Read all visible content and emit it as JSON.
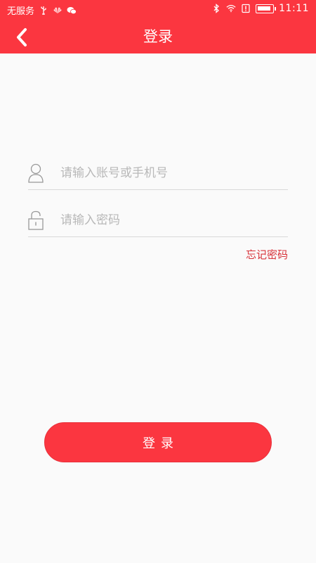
{
  "status_bar": {
    "carrier": "无服务",
    "time": "11:11",
    "left_icons": [
      "usb-icon",
      "huawei-icon",
      "wechat-icon"
    ],
    "right_icons": [
      "bluetooth-icon",
      "wifi-icon",
      "alert-icon",
      "battery-icon"
    ]
  },
  "header": {
    "title": "登录",
    "back_icon": "chevron-left-icon",
    "color": "#fb3640"
  },
  "form": {
    "account": {
      "icon": "user-icon",
      "value": "",
      "placeholder": "请输入账号或手机号"
    },
    "password": {
      "icon": "lock-icon",
      "value": "",
      "placeholder": "请输入密码"
    },
    "forgot_password_label": "忘记密码"
  },
  "login_button": {
    "label": "登录",
    "color": "#fb3640"
  }
}
